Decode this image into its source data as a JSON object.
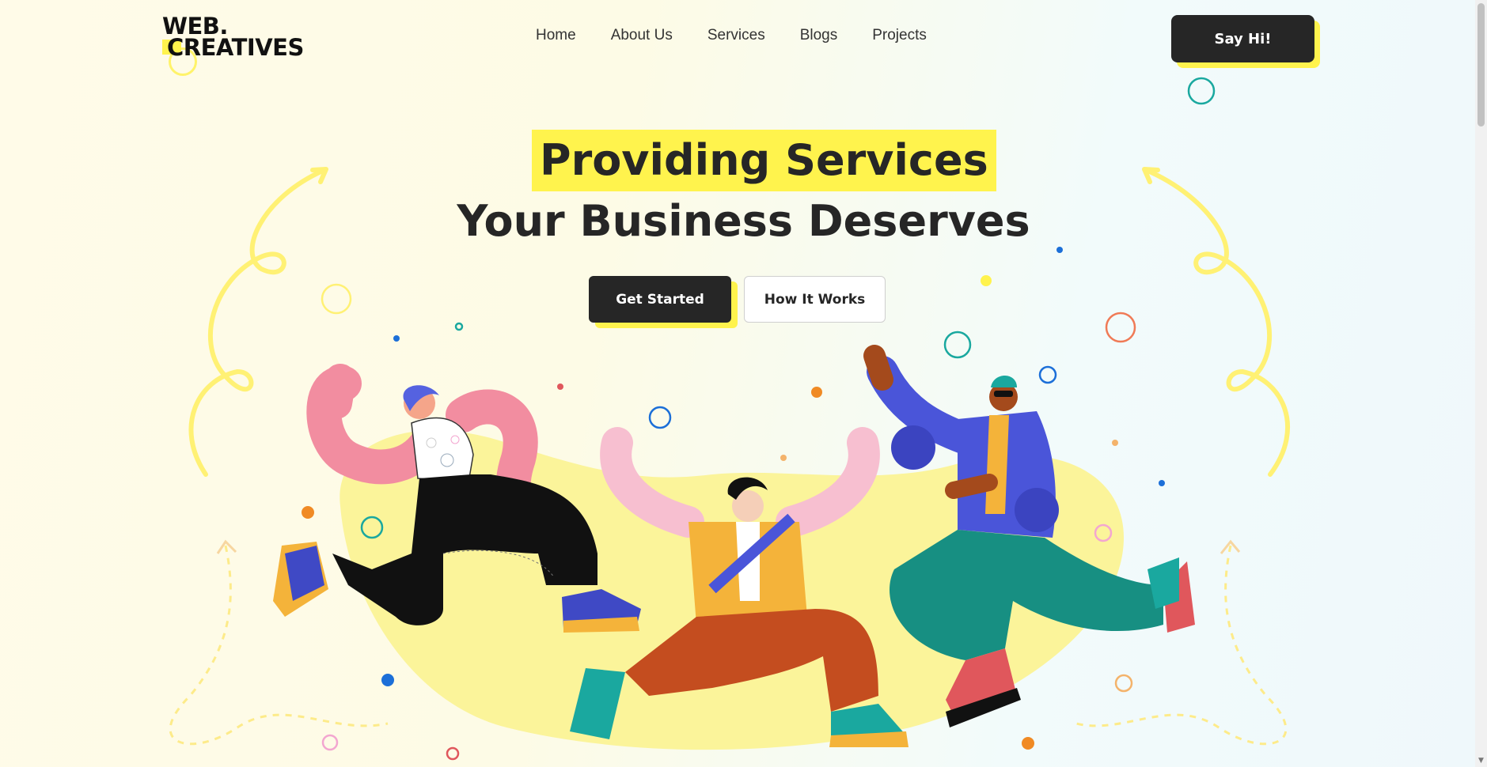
{
  "brand": {
    "line1": "WEB.",
    "line2": "CREATIVES"
  },
  "nav": {
    "items": [
      "Home",
      "About Us",
      "Services",
      "Blogs",
      "Projects"
    ]
  },
  "header_cta": "Say Hi!",
  "hero": {
    "title_highlight": "Providing Services",
    "title_rest": "Your Business Deserves",
    "primary_button": "Get Started",
    "secondary_button": "How It Works"
  },
  "colors": {
    "accent": "#fff34d",
    "dark": "#262626",
    "teal": "#1aa89f",
    "blue": "#4a55d9",
    "orange": "#f08a24"
  }
}
